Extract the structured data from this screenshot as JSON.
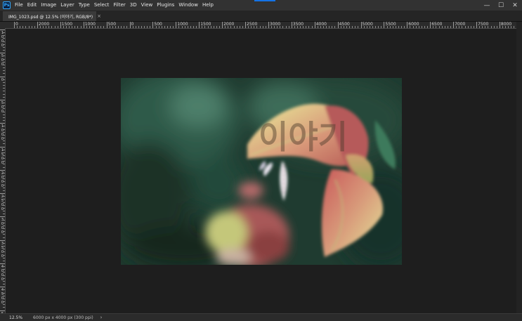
{
  "app": {
    "logo_text": "Ps"
  },
  "menu": [
    "File",
    "Edit",
    "Image",
    "Layer",
    "Type",
    "Select",
    "Filter",
    "3D",
    "View",
    "Plugins",
    "Window",
    "Help"
  ],
  "window_controls": {
    "minimize": "—",
    "maximize": "☐",
    "close": "✕"
  },
  "tab": {
    "title": "IMG_1023.psd @ 12.5% (이야기, RGB/8*)",
    "close": "×"
  },
  "ruler_h": [
    "0",
    "2000",
    "1500",
    "1000",
    "500",
    "0",
    "500",
    "1000",
    "1500",
    "2000",
    "2500",
    "3000",
    "3500",
    "4000",
    "4500",
    "5000",
    "5500",
    "6000",
    "6500",
    "7000",
    "7500",
    "8000"
  ],
  "ruler_v": [
    "1000",
    "500",
    "0",
    "500",
    "1000",
    "1500",
    "2000",
    "2500",
    "3000",
    "3500",
    "4000",
    "4500",
    "5000"
  ],
  "canvas": {
    "watermark": "이야기"
  },
  "status": {
    "zoom": "12.5%",
    "doc_info": "6000 px x 4000 px (300 ppi)",
    "chevron": "›"
  },
  "colors": {
    "accent": "#31a8ff",
    "workspace": "#1e1e1e",
    "panel": "#323232"
  }
}
